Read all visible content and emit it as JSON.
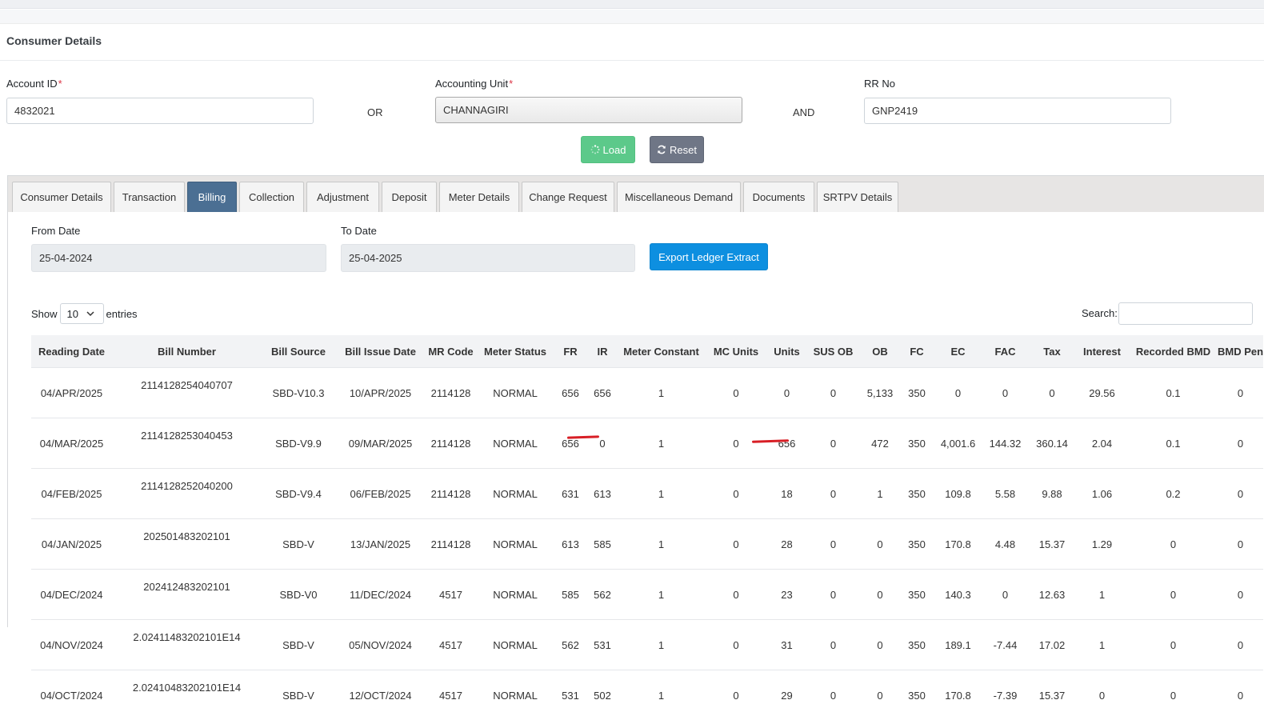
{
  "section": {
    "title": "Consumer Details"
  },
  "search_form": {
    "account_id_label": "Account ID",
    "account_id_value": "4832021",
    "or_label": "OR",
    "accounting_unit_label": "Accounting Unit",
    "accounting_unit_value": "CHANNAGIRI",
    "and_label": "AND",
    "rr_no_label": "RR No",
    "rr_no_value": "GNP2419",
    "required_mark": "*",
    "load_label": "Load",
    "reset_label": "Reset"
  },
  "tabs": [
    {
      "label": "Consumer Details"
    },
    {
      "label": "Transaction"
    },
    {
      "label": "Billing",
      "active": true
    },
    {
      "label": "Collection"
    },
    {
      "label": "Adjustment"
    },
    {
      "label": "Deposit"
    },
    {
      "label": "Meter Details"
    },
    {
      "label": "Change Request"
    },
    {
      "label": "Miscellaneous Demand"
    },
    {
      "label": "Documents"
    },
    {
      "label": "SRTPV Details"
    }
  ],
  "billing": {
    "from_date_label": "From Date",
    "from_date_value": "25-04-2024",
    "to_date_label": "To Date",
    "to_date_value": "25-04-2025",
    "export_label": "Export Ledger Extract",
    "show_label": "Show",
    "page_length": "10",
    "entries_label": "entries",
    "search_label": "Search:"
  },
  "table": {
    "columns": [
      "Reading Date",
      "Bill Number",
      "Bill Source",
      "Bill Issue Date",
      "MR Code",
      "Meter Status",
      "FR",
      "IR",
      "Meter Constant",
      "MC Units",
      "Units",
      "SUS OB",
      "OB",
      "FC",
      "EC",
      "FAC",
      "Tax",
      "Interest",
      "Recorded BMD",
      "BMD Pen"
    ],
    "rows": [
      [
        "04/APR/2025",
        "2114128254040707",
        "SBD-V10.3",
        "10/APR/2025",
        "2114128",
        "NORMAL",
        "656",
        "656",
        "1",
        "0",
        "0",
        "0",
        "5,133",
        "350",
        "0",
        "0",
        "0",
        "29.56",
        "0.1",
        "0"
      ],
      [
        "04/MAR/2025",
        "2114128253040453",
        "SBD-V9.9",
        "09/MAR/2025",
        "2114128",
        "NORMAL",
        "656",
        "0",
        "1",
        "0",
        "656",
        "0",
        "472",
        "350",
        "4,001.6",
        "144.32",
        "360.14",
        "2.04",
        "0.1",
        "0"
      ],
      [
        "04/FEB/2025",
        "2114128252040200",
        "SBD-V9.4",
        "06/FEB/2025",
        "2114128",
        "NORMAL",
        "631",
        "613",
        "1",
        "0",
        "18",
        "0",
        "1",
        "350",
        "109.8",
        "5.58",
        "9.88",
        "1.06",
        "0.2",
        "0"
      ],
      [
        "04/JAN/2025",
        "202501483202101",
        "SBD-V",
        "13/JAN/2025",
        "2114128",
        "NORMAL",
        "613",
        "585",
        "1",
        "0",
        "28",
        "0",
        "0",
        "350",
        "170.8",
        "4.48",
        "15.37",
        "1.29",
        "0",
        "0"
      ],
      [
        "04/DEC/2024",
        "202412483202101",
        "SBD-V0",
        "11/DEC/2024",
        "4517",
        "NORMAL",
        "585",
        "562",
        "1",
        "0",
        "23",
        "0",
        "0",
        "350",
        "140.3",
        "0",
        "12.63",
        "1",
        "0",
        "0"
      ],
      [
        "04/NOV/2024",
        "2.02411483202101E14",
        "SBD-V",
        "05/NOV/2024",
        "4517",
        "NORMAL",
        "562",
        "531",
        "1",
        "0",
        "31",
        "0",
        "0",
        "350",
        "189.1",
        "-7.44",
        "17.02",
        "1",
        "0",
        "0"
      ],
      [
        "04/OCT/2024",
        "2.02410483202101E14",
        "SBD-V",
        "12/OCT/2024",
        "4517",
        "NORMAL",
        "531",
        "502",
        "1",
        "0",
        "29",
        "0",
        "0",
        "350",
        "170.8",
        "-7.39",
        "15.37",
        "0",
        "0",
        "0"
      ]
    ]
  },
  "colors": {
    "active_tab": "#4b6f93",
    "load_button": "#5cc98a",
    "reset_button": "#6f7686",
    "export_button": "#0d8fe0",
    "annotation": "#d81f26"
  }
}
